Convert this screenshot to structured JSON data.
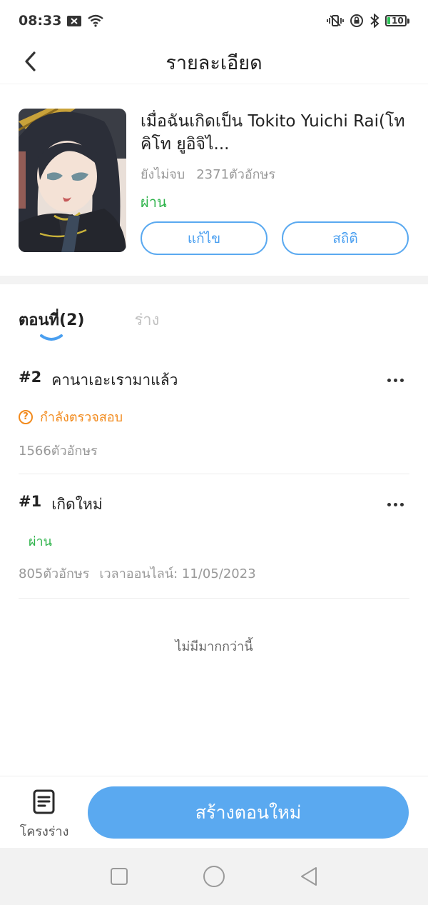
{
  "status_bar": {
    "time": "08:33",
    "battery": "10"
  },
  "header": {
    "title": "รายละเอียด"
  },
  "book": {
    "title": "เมื่อฉันเกิดเป็น Tokito Yuichi Rai(โทคิโท ยูอิจิไ...",
    "progress_status": "ยังไม่จบ",
    "char_count": "2371ตัวอักษร",
    "review_status": "ผ่าน",
    "edit_label": "แก้ไข",
    "stats_label": "สถิติ"
  },
  "tabs": [
    {
      "label": "ตอนที่(2)"
    },
    {
      "label": "ร่าง"
    }
  ],
  "chapters": [
    {
      "number": "#2",
      "title": "คานาเอะเรามาแล้ว",
      "status": "กำลังตรวจสอบ",
      "chars": "1566ตัวอักษร",
      "online_time": ""
    },
    {
      "number": "#1",
      "title": "เกิดใหม่",
      "status": "ผ่าน",
      "chars": "805ตัวอักษร",
      "online_time": "เวลาออนไลน์:  11/05/2023"
    }
  ],
  "list_footer": "ไม่มีมากกว่านี้",
  "bottom": {
    "outline_label": "โครงร่าง",
    "create_label": "สร้างตอนใหม่"
  },
  "colors": {
    "accent": "#5aa9f0",
    "pass": "#2db34a",
    "review": "#f28a1c"
  }
}
